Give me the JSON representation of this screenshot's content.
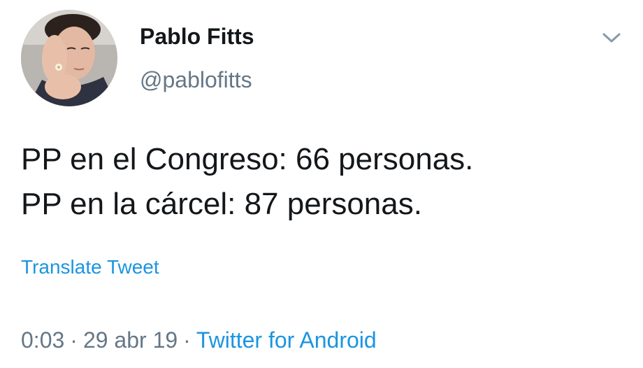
{
  "user": {
    "display_name": "Pablo Fitts",
    "handle": "@pablofitts"
  },
  "tweet": {
    "lines": [
      "PP en el Congreso: 66 personas.",
      "PP en la cárcel: 87 personas."
    ],
    "translate_label": "Translate Tweet"
  },
  "meta": {
    "time": "0:03",
    "separator": "·",
    "date": "29 abr 19",
    "source": "Twitter for Android"
  },
  "icons": {
    "caret": "chevron-down-icon"
  },
  "colors": {
    "text": "#14171a",
    "secondary": "#657786",
    "link": "#1b95e0"
  }
}
